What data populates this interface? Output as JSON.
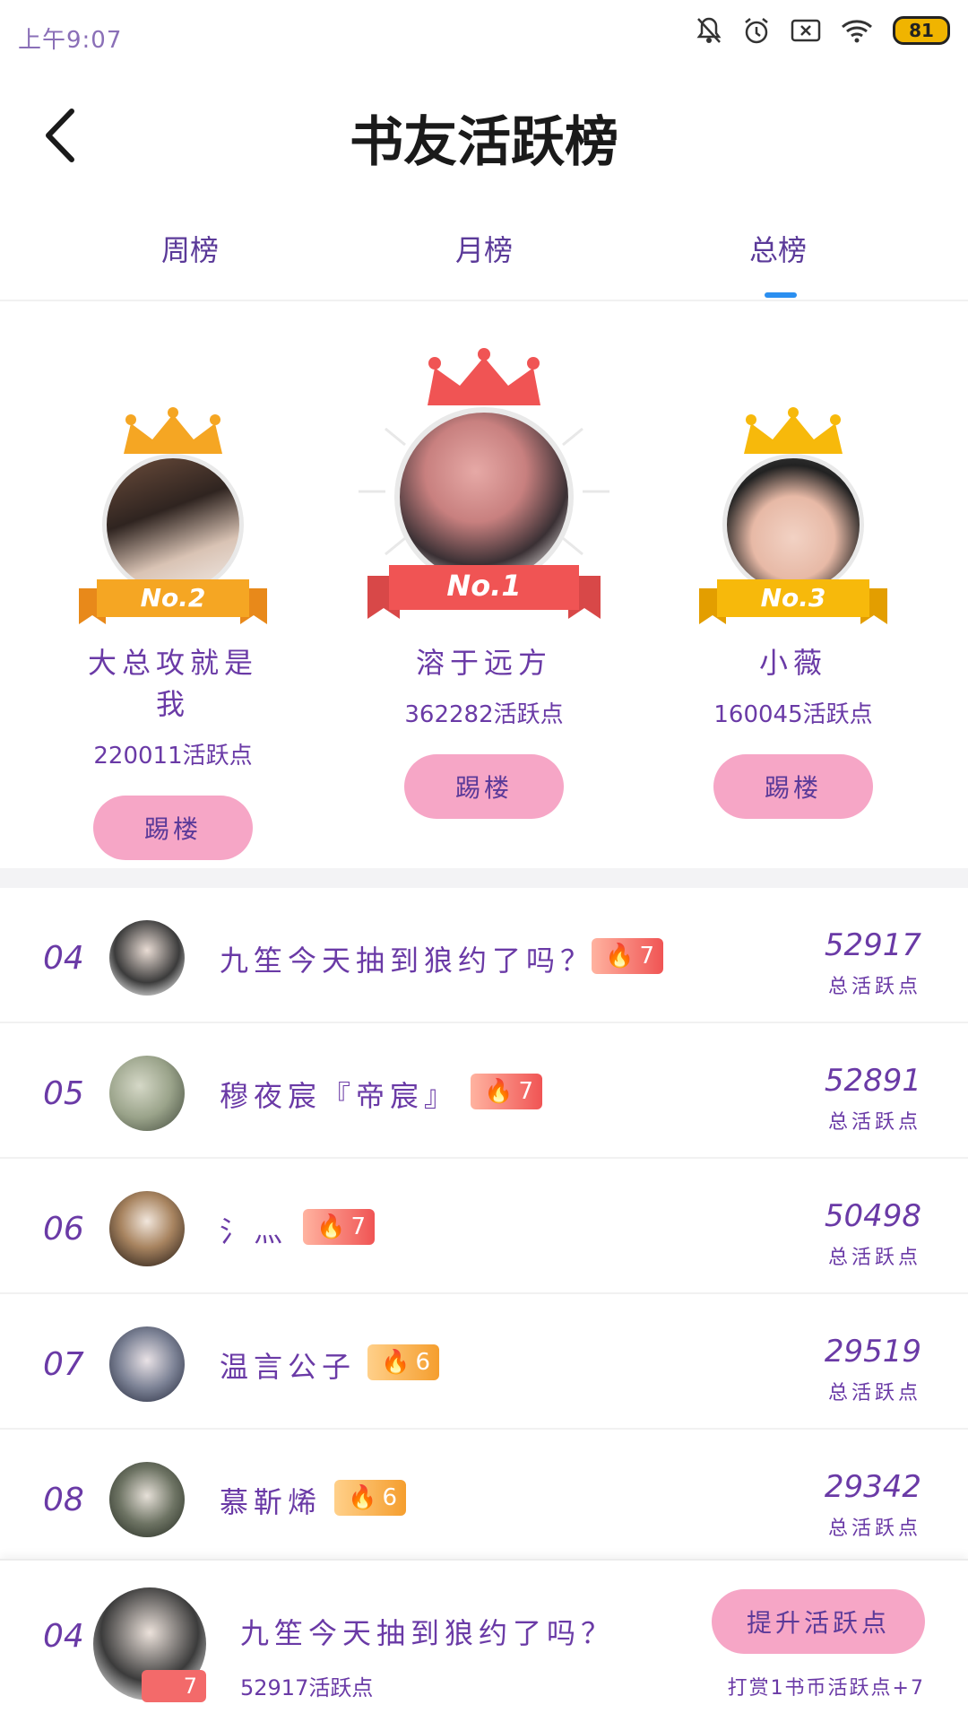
{
  "status_bar": {
    "time": "上午9:07",
    "battery": "81",
    "icons": [
      "bell-off-icon",
      "alarm-icon",
      "sim-off-icon",
      "wifi-icon",
      "battery-icon"
    ]
  },
  "header": {
    "title": "书友活跃榜",
    "back_icon": "back-arrow-icon"
  },
  "tabs": [
    {
      "label": "周榜",
      "active": false
    },
    {
      "label": "月榜",
      "active": false
    },
    {
      "label": "总榜",
      "active": true
    }
  ],
  "podium": [
    {
      "rank_label": "No.2",
      "name": "大总攻就是我",
      "points": "220011活跃点",
      "button": "踢楼"
    },
    {
      "rank_label": "No.1",
      "name": "溶于远方",
      "points": "362282活跃点",
      "button": "踢楼"
    },
    {
      "rank_label": "No.3",
      "name": "小薇",
      "points": "160045活跃点",
      "button": "踢楼"
    }
  ],
  "list": [
    {
      "rank": "04",
      "name": "九笙今天抽到狼约了吗？",
      "level": "7",
      "score": "52917",
      "score_label": "总活跃点"
    },
    {
      "rank": "05",
      "name": "穆夜宸『帝宸』",
      "level": "7",
      "score": "52891",
      "score_label": "总活跃点"
    },
    {
      "rank": "06",
      "name": "氵灬",
      "level": "7",
      "score": "50498",
      "score_label": "总活跃点"
    },
    {
      "rank": "07",
      "name": "温言公子",
      "level": "6",
      "score": "29519",
      "score_label": "总活跃点"
    },
    {
      "rank": "08",
      "name": "慕靳烯",
      "level": "6",
      "score": "29342",
      "score_label": "总活跃点"
    }
  ],
  "my_rank": {
    "rank": "04",
    "name": "九笙今天抽到狼约了吗？",
    "level": "7",
    "points": "52917活跃点",
    "button": "提升活跃点",
    "hint": "打赏1书币活跃点+7"
  },
  "colors": {
    "accent_text": "#6a3aa6",
    "button_pink": "#f6a6c6",
    "tab_indicator": "#2b8ff0",
    "gold": "#f5a623",
    "red": "#f05454",
    "yellow": "#f7b90b"
  }
}
